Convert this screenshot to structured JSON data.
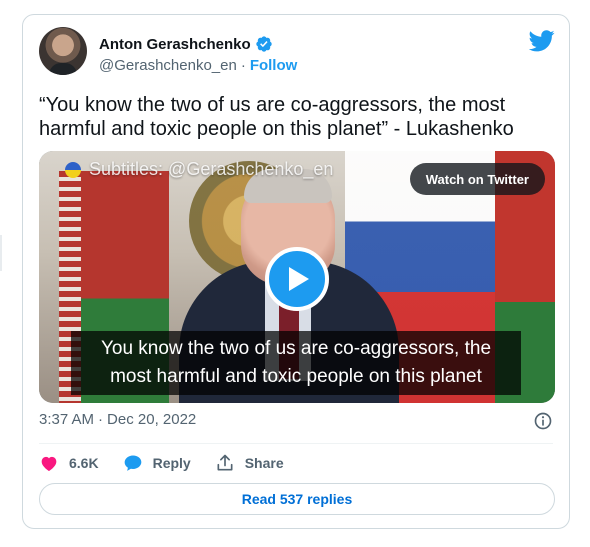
{
  "author": {
    "name": "Anton Gerashchenko",
    "handle": "@Gerashchenko_en",
    "separator": "·",
    "follow_label": "Follow"
  },
  "tweet": {
    "text": "“You know the two of us are co-aggressors, the most harmful and toxic people on this planet” - Lukashenko"
  },
  "media": {
    "subtitle_watermark": "Subtitles: @Gerashchenko_en",
    "watch_label": "Watch on Twitter",
    "caption_line1": "You know the two of us are co-aggressors, the",
    "caption_line2": "most harmful and toxic people on this planet"
  },
  "meta": {
    "time": "3:37 AM",
    "separator": "·",
    "date": "Dec 20, 2022"
  },
  "actions": {
    "likes": "6.6K",
    "reply_label": "Reply",
    "share_label": "Share"
  },
  "read_replies_label": "Read 537 replies",
  "colors": {
    "accent": "#1d9bf0",
    "like": "#f91880",
    "text": "#0f1419",
    "muted": "#536471"
  },
  "icons": [
    "verified-badge-icon",
    "twitter-bird-icon",
    "play-icon",
    "info-icon",
    "heart-icon",
    "reply-bubble-icon",
    "share-icon",
    "ukraine-flag-icon"
  ]
}
